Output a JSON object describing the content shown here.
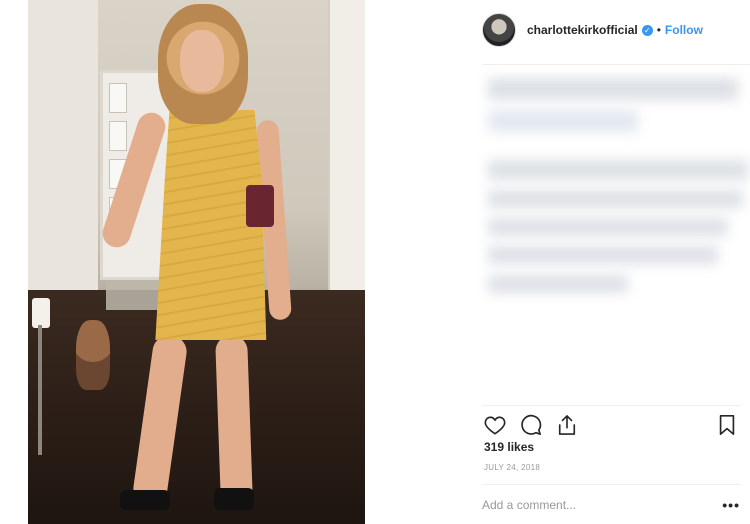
{
  "post": {
    "username": "charlottekirkofficial",
    "verified_icon": "verified-badge-icon",
    "separator": "•",
    "follow_label": "Follow",
    "likes": "319 likes",
    "date": "JULY 24, 2018",
    "comment_placeholder": "Add a comment...",
    "more_label": "•••"
  },
  "icons": {
    "like": "heart-icon",
    "comment": "comment-bubble-icon",
    "share": "share-icon",
    "save": "bookmark-icon"
  },
  "colors": {
    "accent": "#3897f0",
    "text": "#262626",
    "muted": "#999999",
    "border": "#efefef"
  }
}
